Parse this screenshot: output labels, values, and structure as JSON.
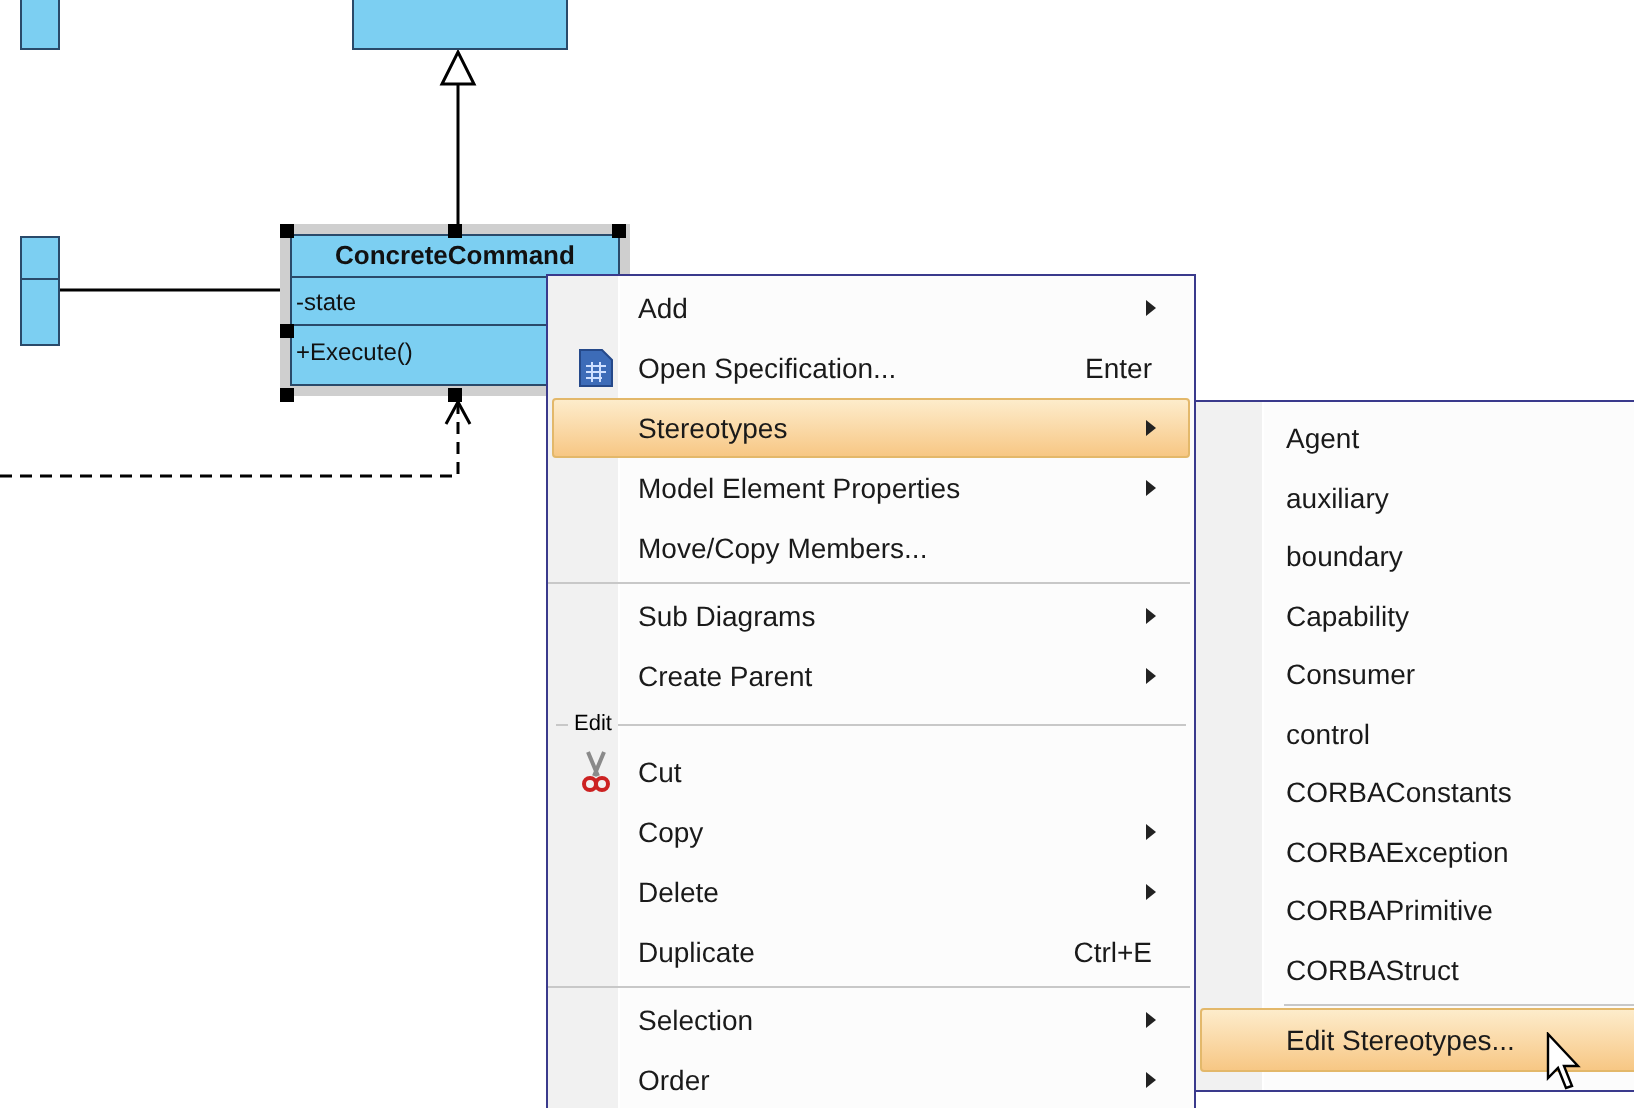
{
  "diagram": {
    "class": {
      "name": "ConcreteCommand",
      "attributes": [
        "-state"
      ],
      "operations": [
        "+Execute()"
      ],
      "selected": true
    }
  },
  "context_menu": {
    "items": [
      {
        "kind": "item",
        "label": "Add",
        "submenu": true,
        "selected": false
      },
      {
        "kind": "spec_item",
        "label": "Open Specification...",
        "shortcut": "Enter",
        "submenu": false,
        "selected": false
      },
      {
        "kind": "item",
        "label": "Stereotypes",
        "submenu": true,
        "selected": true
      },
      {
        "kind": "item",
        "label": "Model Element Properties",
        "submenu": true,
        "selected": false
      },
      {
        "kind": "item",
        "label": "Move/Copy Members...",
        "submenu": false,
        "selected": false
      },
      {
        "kind": "separator"
      },
      {
        "kind": "item",
        "label": "Sub Diagrams",
        "submenu": true,
        "selected": false
      },
      {
        "kind": "item",
        "label": "Create Parent",
        "submenu": true,
        "selected": false
      },
      {
        "kind": "section",
        "label": "Edit"
      },
      {
        "kind": "cut_item",
        "label": "Cut",
        "submenu": false,
        "selected": false
      },
      {
        "kind": "item",
        "label": "Copy",
        "submenu": true,
        "selected": false
      },
      {
        "kind": "item",
        "label": "Delete",
        "submenu": true,
        "selected": false
      },
      {
        "kind": "item",
        "label": "Duplicate",
        "shortcut": "Ctrl+E",
        "submenu": false,
        "selected": false
      },
      {
        "kind": "separator"
      },
      {
        "kind": "item",
        "label": "Selection",
        "submenu": true,
        "selected": false
      },
      {
        "kind": "item",
        "label": "Order",
        "submenu": true,
        "selected": false
      }
    ]
  },
  "submenu": {
    "items": [
      {
        "kind": "item",
        "label": "Agent",
        "selected": false
      },
      {
        "kind": "item",
        "label": "auxiliary",
        "selected": false
      },
      {
        "kind": "item",
        "label": "boundary",
        "selected": false
      },
      {
        "kind": "item",
        "label": "Capability",
        "selected": false
      },
      {
        "kind": "item",
        "label": "Consumer",
        "selected": false
      },
      {
        "kind": "item",
        "label": "control",
        "selected": false
      },
      {
        "kind": "item",
        "label": "CORBAConstants",
        "selected": false
      },
      {
        "kind": "item",
        "label": "CORBAException",
        "selected": false
      },
      {
        "kind": "item",
        "label": "CORBAPrimitive",
        "selected": false
      },
      {
        "kind": "item",
        "label": "CORBAStruct",
        "selected": false
      },
      {
        "kind": "separator"
      },
      {
        "kind": "item",
        "label": "Edit Stereotypes...",
        "selected": true
      }
    ]
  }
}
